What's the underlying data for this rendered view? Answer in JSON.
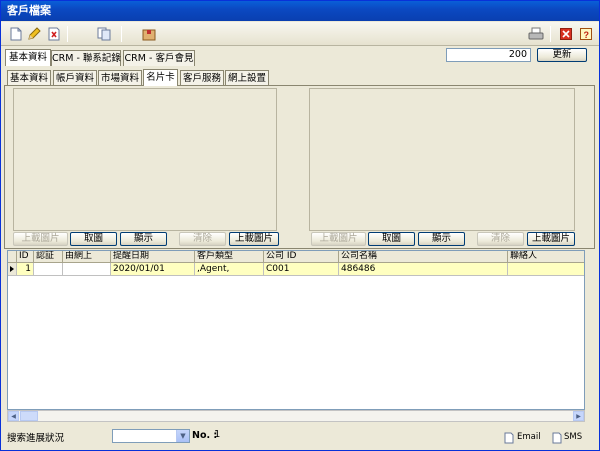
{
  "window": {
    "title": "客戶檔案"
  },
  "toolbar": {
    "icons": [
      "new-doc-icon",
      "edit-pencil-icon",
      "delete-doc-icon",
      "copy-doc-icon",
      "package-icon",
      "print-icon",
      "close-red-icon",
      "help-icon"
    ]
  },
  "top_tabs": [
    {
      "label": "基本資料"
    },
    {
      "label": "CRM - 聯系記錄"
    },
    {
      "label": "CRM - 客戶會見"
    }
  ],
  "record_number": "200",
  "update_button": "更新",
  "sub_tabs": [
    {
      "label": "基本資料"
    },
    {
      "label": "帳戶資料"
    },
    {
      "label": "市場資料"
    },
    {
      "label": "名片卡"
    },
    {
      "label": "客戶服務"
    },
    {
      "label": "網上設置"
    }
  ],
  "card_left": {
    "upload": "上載圖片",
    "cancel": "取圖",
    "show": "顯示",
    "clear": "清除",
    "upload2": "上載圖片"
  },
  "card_right": {
    "upload": "上載圖片",
    "cancel": "取圖",
    "show": "顯示",
    "clear": "清除",
    "upload2": "上載圖片"
  },
  "grid": {
    "columns": [
      "ID",
      "認証",
      "由網上",
      "提醒日期",
      "客戶類型",
      "公司 ID",
      "公司名稱",
      "聯絡人"
    ],
    "rows": [
      {
        "id": "1",
        "verified": "",
        "online": "",
        "remind_date": "2020/01/01",
        "customer_type": ",Agent,",
        "company_id": "C001",
        "company_name": "486486",
        "contact": ""
      }
    ]
  },
  "status": {
    "search_label": "搜索進展狀況",
    "no_label": "No. :",
    "no_value": "1",
    "email_label": "Email",
    "sms_label": "SMS"
  }
}
